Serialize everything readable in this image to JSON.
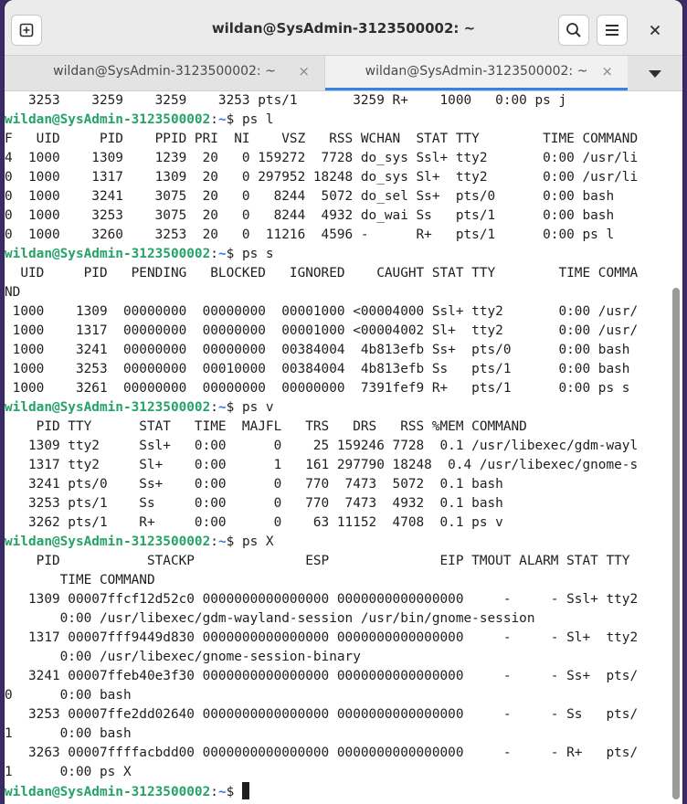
{
  "window": {
    "title": "wildan@SysAdmin-3123500002: ~",
    "new_tab_icon": "new-tab-icon",
    "search_icon": "search-icon",
    "menu_icon": "hamburger-menu-icon",
    "close_icon": "close-icon"
  },
  "tabs": [
    {
      "label": "wildan@SysAdmin-3123500002: ~",
      "active": false,
      "close": "×"
    },
    {
      "label": "wildan@SysAdmin-3123500002: ~",
      "active": true,
      "close": "×"
    }
  ],
  "tab_overflow_icon": "chevron-down-icon",
  "colors": {
    "prompt_user": "#26a269",
    "prompt_dir": "#2a7bde",
    "tab_accent": "#3584e4",
    "text": "#1e1e1e"
  },
  "terminal": {
    "prompt_user": "wildan@SysAdmin-3123500002",
    "prompt_sep": ":",
    "prompt_dir": "~",
    "prompt_symbol": "$ ",
    "lines": [
      {
        "type": "out",
        "text": "   3253    3259    3259    3253 pts/1       3259 R+    1000   0:00 ps j"
      },
      {
        "type": "cmd",
        "text": "ps l"
      },
      {
        "type": "out",
        "text": "F   UID     PID    PPID PRI  NI    VSZ   RSS WCHAN  STAT TTY        TIME COMMAND"
      },
      {
        "type": "out",
        "text": "4  1000    1309    1239  20   0 159272  7728 do_sys Ssl+ tty2       0:00 /usr/li"
      },
      {
        "type": "out",
        "text": "0  1000    1317    1309  20   0 297952 18248 do_sys Sl+  tty2       0:00 /usr/li"
      },
      {
        "type": "out",
        "text": "0  1000    3241    3075  20   0   8244  5072 do_sel Ss+  pts/0      0:00 bash"
      },
      {
        "type": "out",
        "text": "0  1000    3253    3075  20   0   8244  4932 do_wai Ss   pts/1      0:00 bash"
      },
      {
        "type": "out",
        "text": "0  1000    3260    3253  20   0  11216  4596 -      R+   pts/1      0:00 ps l"
      },
      {
        "type": "cmd",
        "text": "ps s"
      },
      {
        "type": "out",
        "text": "  UID     PID   PENDING   BLOCKED   IGNORED    CAUGHT STAT TTY        TIME COMMA"
      },
      {
        "type": "out",
        "text": "ND"
      },
      {
        "type": "out",
        "text": " 1000    1309  00000000  00000000  00001000 <00004000 Ssl+ tty2       0:00 /usr/"
      },
      {
        "type": "out",
        "text": " 1000    1317  00000000  00000000  00001000 <00004002 Sl+  tty2       0:00 /usr/"
      },
      {
        "type": "out",
        "text": " 1000    3241  00000000  00000000  00384004  4b813efb Ss+  pts/0      0:00 bash"
      },
      {
        "type": "out",
        "text": " 1000    3253  00000000  00010000  00384004  4b813efb Ss   pts/1      0:00 bash"
      },
      {
        "type": "out",
        "text": " 1000    3261  00000000  00000000  00000000  7391fef9 R+   pts/1      0:00 ps s"
      },
      {
        "type": "cmd",
        "text": "ps v"
      },
      {
        "type": "out",
        "text": "    PID TTY      STAT   TIME  MAJFL   TRS   DRS   RSS %MEM COMMAND"
      },
      {
        "type": "out",
        "text": "   1309 tty2     Ssl+   0:00      0    25 159246 7728  0.1 /usr/libexec/gdm-wayl"
      },
      {
        "type": "out",
        "text": "   1317 tty2     Sl+    0:00      1   161 297790 18248  0.4 /usr/libexec/gnome-s"
      },
      {
        "type": "out",
        "text": "   3241 pts/0    Ss+    0:00      0   770  7473  5072  0.1 bash"
      },
      {
        "type": "out",
        "text": "   3253 pts/1    Ss     0:00      0   770  7473  4932  0.1 bash"
      },
      {
        "type": "out",
        "text": "   3262 pts/1    R+     0:00      0    63 11152  4708  0.1 ps v"
      },
      {
        "type": "cmd",
        "text": "ps X"
      },
      {
        "type": "out",
        "text": "    PID           STACKP              ESP              EIP TMOUT ALARM STAT TTY"
      },
      {
        "type": "out",
        "text": "       TIME COMMAND"
      },
      {
        "type": "out",
        "text": "   1309 00007ffcf12d52c0 0000000000000000 0000000000000000     -     - Ssl+ tty2"
      },
      {
        "type": "out",
        "text": "       0:00 /usr/libexec/gdm-wayland-session /usr/bin/gnome-session"
      },
      {
        "type": "out",
        "text": "   1317 00007fff9449d830 0000000000000000 0000000000000000     -     - Sl+  tty2"
      },
      {
        "type": "out",
        "text": "       0:00 /usr/libexec/gnome-session-binary"
      },
      {
        "type": "out",
        "text": "   3241 00007ffeb40e3f30 0000000000000000 0000000000000000     -     - Ss+  pts/"
      },
      {
        "type": "out",
        "text": "0      0:00 bash"
      },
      {
        "type": "out",
        "text": "   3253 00007ffe2dd02640 0000000000000000 0000000000000000     -     - Ss   pts/"
      },
      {
        "type": "out",
        "text": "1      0:00 bash"
      },
      {
        "type": "out",
        "text": "   3263 00007ffffacbdd00 0000000000000000 0000000000000000     -     - R+   pts/"
      },
      {
        "type": "out",
        "text": "1      0:00 ps X"
      },
      {
        "type": "cmd",
        "text": "",
        "cursor": true
      }
    ]
  }
}
